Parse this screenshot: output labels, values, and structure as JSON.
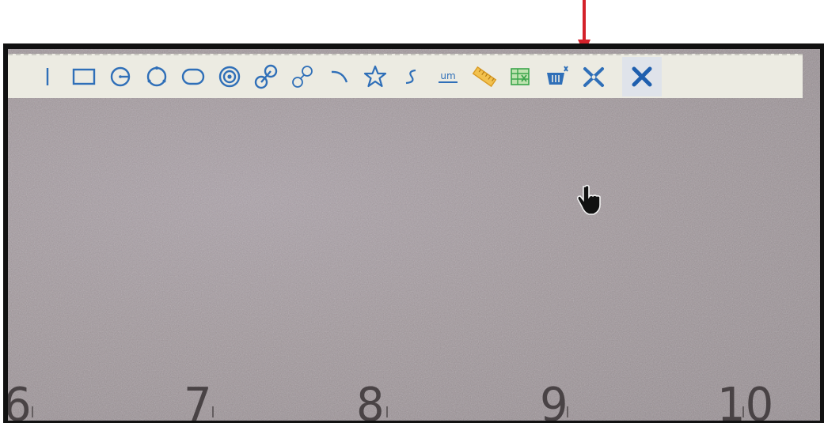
{
  "toolbar": {
    "tools": [
      {
        "id": "line",
        "icon": "line-icon"
      },
      {
        "id": "rectangle",
        "icon": "rectangle-icon"
      },
      {
        "id": "circle-radius",
        "icon": "circle-radius-icon"
      },
      {
        "id": "circle-three-point",
        "icon": "circle-three-point-icon"
      },
      {
        "id": "ellipse",
        "icon": "ellipse-icon"
      },
      {
        "id": "concentric-circles",
        "icon": "concentric-circles-icon"
      },
      {
        "id": "circle-to-circle-distance",
        "icon": "circle-distance-icon"
      },
      {
        "id": "two-circles",
        "icon": "two-circles-icon"
      },
      {
        "id": "arc",
        "icon": "arc-icon"
      },
      {
        "id": "star",
        "icon": "star-icon"
      },
      {
        "id": "curve",
        "icon": "curve-icon"
      },
      {
        "id": "unit",
        "icon": "unit-ruler-icon",
        "label": "um"
      },
      {
        "id": "calibration",
        "icon": "calibration-ruler-icon"
      },
      {
        "id": "export-excel",
        "icon": "spreadsheet-icon"
      },
      {
        "id": "clear",
        "icon": "basket-clear-icon"
      },
      {
        "id": "delete",
        "icon": "delete-cross-icon"
      },
      {
        "id": "close",
        "icon": "close-icon"
      }
    ]
  },
  "camera_view": {
    "ruler_numbers": [
      "6",
      "7",
      "8",
      "9",
      "10"
    ]
  },
  "colors": {
    "tool_blue": "#2f6fb8",
    "annotation_red": "#d4212a",
    "ruler_orange": "#e7a92a",
    "excel_green": "#3aa54a",
    "toolbar_bg": "#ecebe2"
  }
}
